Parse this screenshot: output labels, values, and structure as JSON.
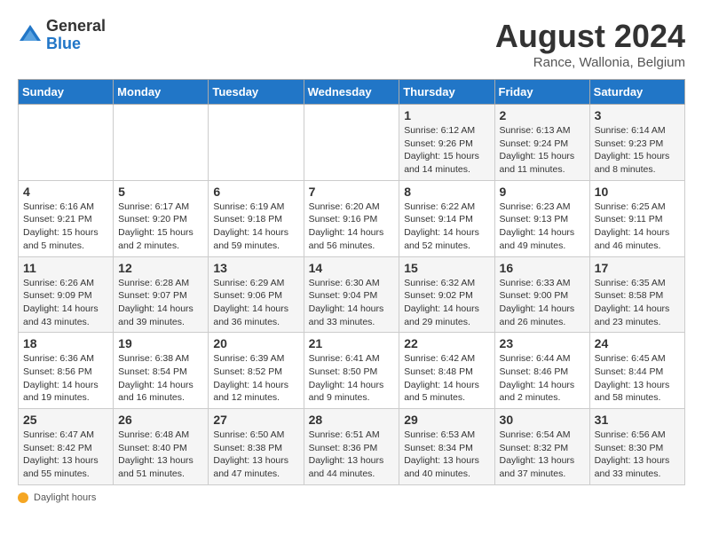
{
  "logo": {
    "general": "General",
    "blue": "Blue"
  },
  "title": {
    "month_year": "August 2024",
    "location": "Rance, Wallonia, Belgium"
  },
  "days_of_week": [
    "Sunday",
    "Monday",
    "Tuesday",
    "Wednesday",
    "Thursday",
    "Friday",
    "Saturday"
  ],
  "weeks": [
    [
      {
        "day": "",
        "info": ""
      },
      {
        "day": "",
        "info": ""
      },
      {
        "day": "",
        "info": ""
      },
      {
        "day": "",
        "info": ""
      },
      {
        "day": "1",
        "info": "Sunrise: 6:12 AM\nSunset: 9:26 PM\nDaylight: 15 hours and 14 minutes."
      },
      {
        "day": "2",
        "info": "Sunrise: 6:13 AM\nSunset: 9:24 PM\nDaylight: 15 hours and 11 minutes."
      },
      {
        "day": "3",
        "info": "Sunrise: 6:14 AM\nSunset: 9:23 PM\nDaylight: 15 hours and 8 minutes."
      }
    ],
    [
      {
        "day": "4",
        "info": "Sunrise: 6:16 AM\nSunset: 9:21 PM\nDaylight: 15 hours and 5 minutes."
      },
      {
        "day": "5",
        "info": "Sunrise: 6:17 AM\nSunset: 9:20 PM\nDaylight: 15 hours and 2 minutes."
      },
      {
        "day": "6",
        "info": "Sunrise: 6:19 AM\nSunset: 9:18 PM\nDaylight: 14 hours and 59 minutes."
      },
      {
        "day": "7",
        "info": "Sunrise: 6:20 AM\nSunset: 9:16 PM\nDaylight: 14 hours and 56 minutes."
      },
      {
        "day": "8",
        "info": "Sunrise: 6:22 AM\nSunset: 9:14 PM\nDaylight: 14 hours and 52 minutes."
      },
      {
        "day": "9",
        "info": "Sunrise: 6:23 AM\nSunset: 9:13 PM\nDaylight: 14 hours and 49 minutes."
      },
      {
        "day": "10",
        "info": "Sunrise: 6:25 AM\nSunset: 9:11 PM\nDaylight: 14 hours and 46 minutes."
      }
    ],
    [
      {
        "day": "11",
        "info": "Sunrise: 6:26 AM\nSunset: 9:09 PM\nDaylight: 14 hours and 43 minutes."
      },
      {
        "day": "12",
        "info": "Sunrise: 6:28 AM\nSunset: 9:07 PM\nDaylight: 14 hours and 39 minutes."
      },
      {
        "day": "13",
        "info": "Sunrise: 6:29 AM\nSunset: 9:06 PM\nDaylight: 14 hours and 36 minutes."
      },
      {
        "day": "14",
        "info": "Sunrise: 6:30 AM\nSunset: 9:04 PM\nDaylight: 14 hours and 33 minutes."
      },
      {
        "day": "15",
        "info": "Sunrise: 6:32 AM\nSunset: 9:02 PM\nDaylight: 14 hours and 29 minutes."
      },
      {
        "day": "16",
        "info": "Sunrise: 6:33 AM\nSunset: 9:00 PM\nDaylight: 14 hours and 26 minutes."
      },
      {
        "day": "17",
        "info": "Sunrise: 6:35 AM\nSunset: 8:58 PM\nDaylight: 14 hours and 23 minutes."
      }
    ],
    [
      {
        "day": "18",
        "info": "Sunrise: 6:36 AM\nSunset: 8:56 PM\nDaylight: 14 hours and 19 minutes."
      },
      {
        "day": "19",
        "info": "Sunrise: 6:38 AM\nSunset: 8:54 PM\nDaylight: 14 hours and 16 minutes."
      },
      {
        "day": "20",
        "info": "Sunrise: 6:39 AM\nSunset: 8:52 PM\nDaylight: 14 hours and 12 minutes."
      },
      {
        "day": "21",
        "info": "Sunrise: 6:41 AM\nSunset: 8:50 PM\nDaylight: 14 hours and 9 minutes."
      },
      {
        "day": "22",
        "info": "Sunrise: 6:42 AM\nSunset: 8:48 PM\nDaylight: 14 hours and 5 minutes."
      },
      {
        "day": "23",
        "info": "Sunrise: 6:44 AM\nSunset: 8:46 PM\nDaylight: 14 hours and 2 minutes."
      },
      {
        "day": "24",
        "info": "Sunrise: 6:45 AM\nSunset: 8:44 PM\nDaylight: 13 hours and 58 minutes."
      }
    ],
    [
      {
        "day": "25",
        "info": "Sunrise: 6:47 AM\nSunset: 8:42 PM\nDaylight: 13 hours and 55 minutes."
      },
      {
        "day": "26",
        "info": "Sunrise: 6:48 AM\nSunset: 8:40 PM\nDaylight: 13 hours and 51 minutes."
      },
      {
        "day": "27",
        "info": "Sunrise: 6:50 AM\nSunset: 8:38 PM\nDaylight: 13 hours and 47 minutes."
      },
      {
        "day": "28",
        "info": "Sunrise: 6:51 AM\nSunset: 8:36 PM\nDaylight: 13 hours and 44 minutes."
      },
      {
        "day": "29",
        "info": "Sunrise: 6:53 AM\nSunset: 8:34 PM\nDaylight: 13 hours and 40 minutes."
      },
      {
        "day": "30",
        "info": "Sunrise: 6:54 AM\nSunset: 8:32 PM\nDaylight: 13 hours and 37 minutes."
      },
      {
        "day": "31",
        "info": "Sunrise: 6:56 AM\nSunset: 8:30 PM\nDaylight: 13 hours and 33 minutes."
      }
    ]
  ],
  "legend": {
    "text": "Daylight hours"
  }
}
